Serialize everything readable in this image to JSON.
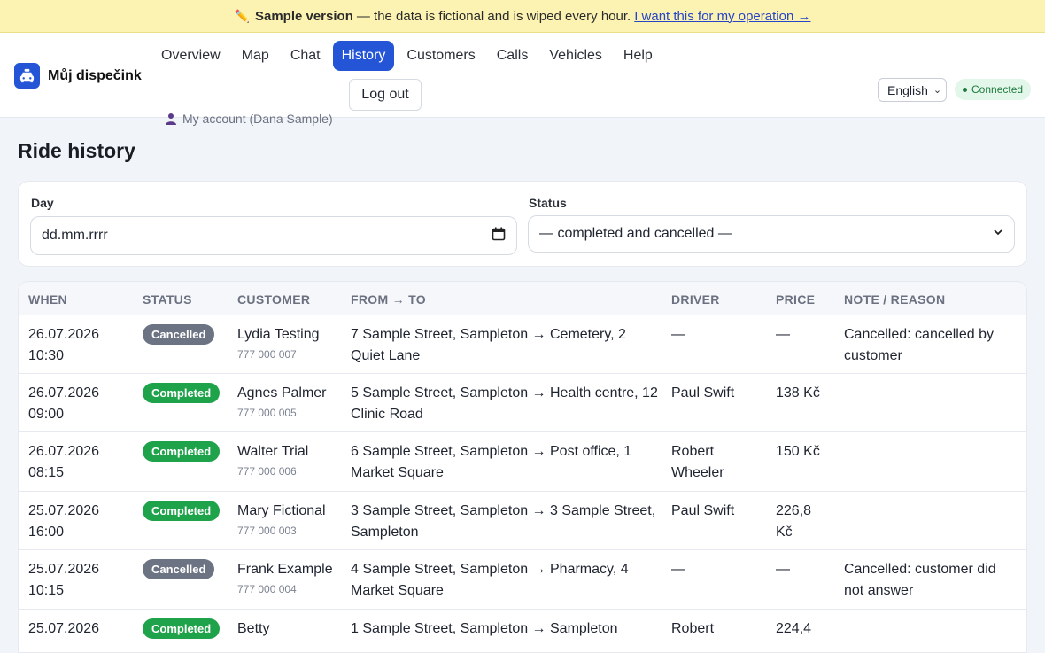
{
  "banner": {
    "title": "Sample version",
    "text": "— the data is fictional and is wiped every hour.",
    "link": "I want this for my operation →"
  },
  "app": {
    "name": "Můj dispečink"
  },
  "nav": {
    "tabs": [
      "Overview",
      "Map",
      "Chat",
      "History",
      "Customers",
      "Calls",
      "Vehicles",
      "Help"
    ],
    "active": "History"
  },
  "account": {
    "label": "My account (Dana Sample)",
    "logout": "Log out"
  },
  "language": {
    "selected": "English"
  },
  "connection": {
    "status": "Connected"
  },
  "page": {
    "title": "Ride history"
  },
  "filters": {
    "day_label": "Day",
    "day_value": "dd.mm.rrrr",
    "status_label": "Status",
    "status_value": "— completed and cancelled —"
  },
  "table": {
    "columns": [
      "WHEN",
      "STATUS",
      "CUSTOMER",
      "FROM → TO",
      "DRIVER",
      "PRICE",
      "NOTE / REASON"
    ],
    "rows": [
      {
        "date": "26.07.2026",
        "time": "10:30",
        "status": "Cancelled",
        "customer": "Lydia Testing",
        "phone": "777 000 007",
        "route1": "7 Sample Street, Sampleton → Cemetery, 2",
        "route2": "Quiet Lane",
        "driver1": "—",
        "driver2": "",
        "price1": "—",
        "price2": "",
        "note1": "Cancelled: cancelled by",
        "note2": "customer"
      },
      {
        "date": "26.07.2026",
        "time": "09:00",
        "status": "Completed",
        "customer": "Agnes Palmer",
        "phone": "777 000 005",
        "route1": "5 Sample Street, Sampleton → Health centre, 12",
        "route2": "Clinic Road",
        "driver1": "Paul Swift",
        "driver2": "",
        "price1": "138 Kč",
        "price2": "",
        "note1": "",
        "note2": ""
      },
      {
        "date": "26.07.2026",
        "time": "08:15",
        "status": "Completed",
        "customer": "Walter Trial",
        "phone": "777 000 006",
        "route1": "6 Sample Street, Sampleton → Post office, 1",
        "route2": "Market Square",
        "driver1": "Robert",
        "driver2": "Wheeler",
        "price1": "150 Kč",
        "price2": "",
        "note1": "",
        "note2": ""
      },
      {
        "date": "25.07.2026",
        "time": "16:00",
        "status": "Completed",
        "customer": "Mary Fictional",
        "phone": "777 000 003",
        "route1": "3 Sample Street, Sampleton → 3 Sample Street,",
        "route2": "Sampleton",
        "driver1": "Paul Swift",
        "driver2": "",
        "price1": "226,8",
        "price2": "Kč",
        "note1": "",
        "note2": ""
      },
      {
        "date": "25.07.2026",
        "time": "10:15",
        "status": "Cancelled",
        "customer": "Frank Example",
        "phone": "777 000 004",
        "route1": "4 Sample Street, Sampleton → Pharmacy, 4",
        "route2": "Market Square",
        "driver1": "—",
        "driver2": "",
        "price1": "—",
        "price2": "",
        "note1": "Cancelled: customer did",
        "note2": "not answer"
      },
      {
        "date": "25.07.2026",
        "time": "",
        "status": "Completed",
        "customer": "Betty",
        "phone": "",
        "route1": "1 Sample Street, Sampleton → Sampleton",
        "route2": "",
        "driver1": "Robert",
        "driver2": "",
        "price1": "224,4",
        "price2": "",
        "note1": "",
        "note2": ""
      }
    ]
  },
  "colors": {
    "accent": "#2355d6",
    "completed": "#1fa34a",
    "cancelled": "#6c7383",
    "banner": "#fcf3b3"
  }
}
